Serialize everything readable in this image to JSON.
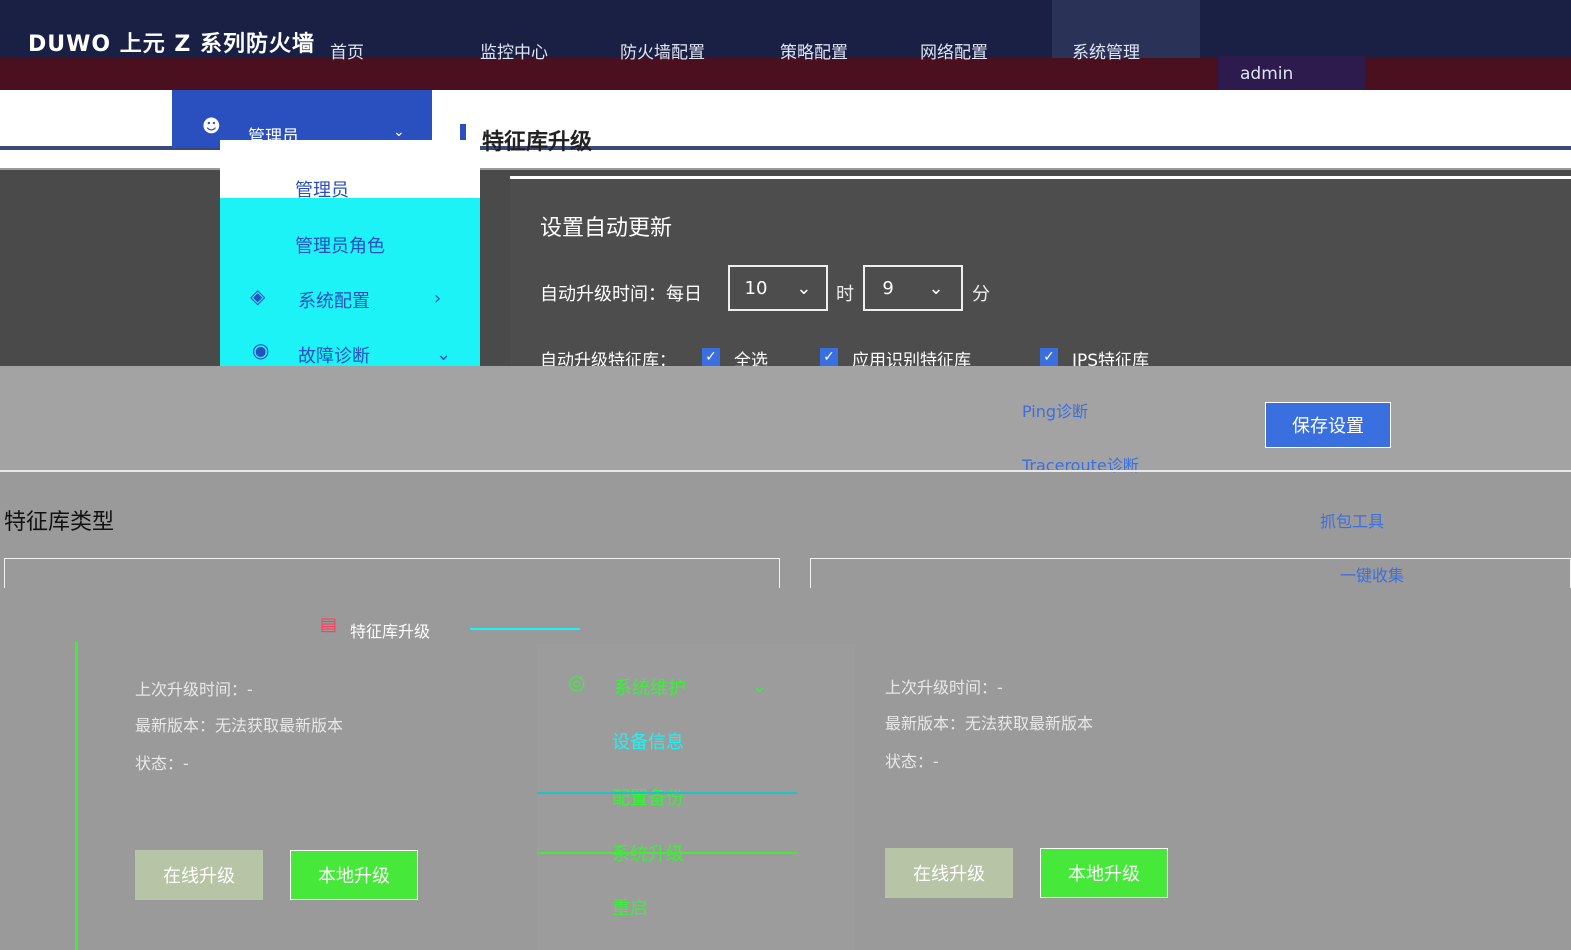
{
  "topbar": {
    "brand": "DUWO 上元 Z 系列防火墙",
    "nav": [
      "首页",
      "监控中心",
      "防火墙配置",
      "策略配置",
      "网络配置",
      "系统管理"
    ],
    "user": "admin"
  },
  "admin_menu": {
    "label": "管理员",
    "items": [
      "管理员",
      "管理员角色",
      "系统配置",
      "故障诊断"
    ]
  },
  "page": {
    "title": "特征库升级"
  },
  "auto_update": {
    "title": "设置自动更新",
    "time_label": "自动升级时间：每日",
    "hour_value": "10",
    "hour_unit": "时",
    "minute_value": "9",
    "minute_unit": "分",
    "scope_label": "自动升级特征库：",
    "options": [
      "全选",
      "应用识别特征库",
      "IPS特征库"
    ]
  },
  "diagnose_submenu": [
    "Ping诊断",
    "Traceroute诊断",
    "抓包工具",
    "一键收集"
  ],
  "save_button": "保存设置",
  "library_type_title": "特征库类型",
  "cards": [
    {
      "last_upgrade": "上次升级时间：-",
      "latest_version": "最新版本：无法获取最新版本",
      "status": "状态：-",
      "online_button": "在线升级",
      "local_button": "本地升级"
    },
    {
      "last_upgrade": "上次升级时间：-",
      "latest_version": "最新版本：无法获取最新版本",
      "status": "状态：-",
      "online_button": "在线升级",
      "local_button": "本地升级"
    }
  ],
  "sidebar_highlight": "特征库升级",
  "system_menu": {
    "label": "系统维护",
    "items": [
      "设备信息",
      "配置备份",
      "系统升级",
      "重启"
    ]
  },
  "colors": {
    "accent": "#3a6fe0",
    "green": "#46e83a",
    "cyan": "#1cf3f7",
    "navy": "#1a2044"
  }
}
